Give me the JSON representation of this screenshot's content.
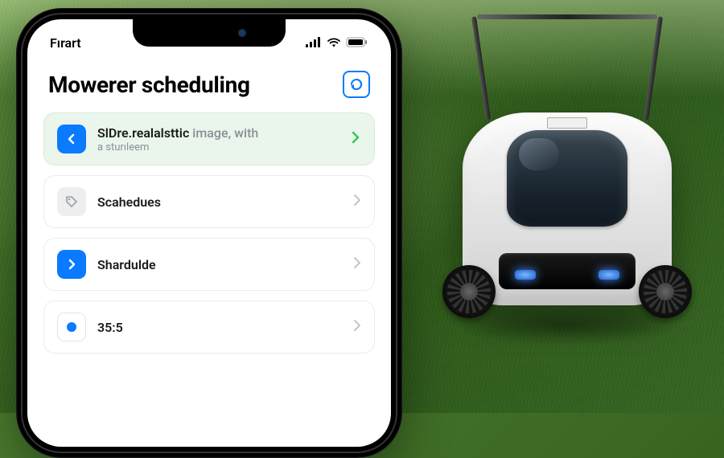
{
  "status_bar": {
    "carrier": "Fırart"
  },
  "header": {
    "title": "Mowerer scheduling"
  },
  "rows": [
    {
      "title_bold": "SlDre.realalsttic",
      "title_rest": " image,  with",
      "subtitle": "a sturıleem"
    },
    {
      "title": "Scahedues"
    },
    {
      "title": "Shardulde"
    },
    {
      "title": "35:5"
    }
  ]
}
